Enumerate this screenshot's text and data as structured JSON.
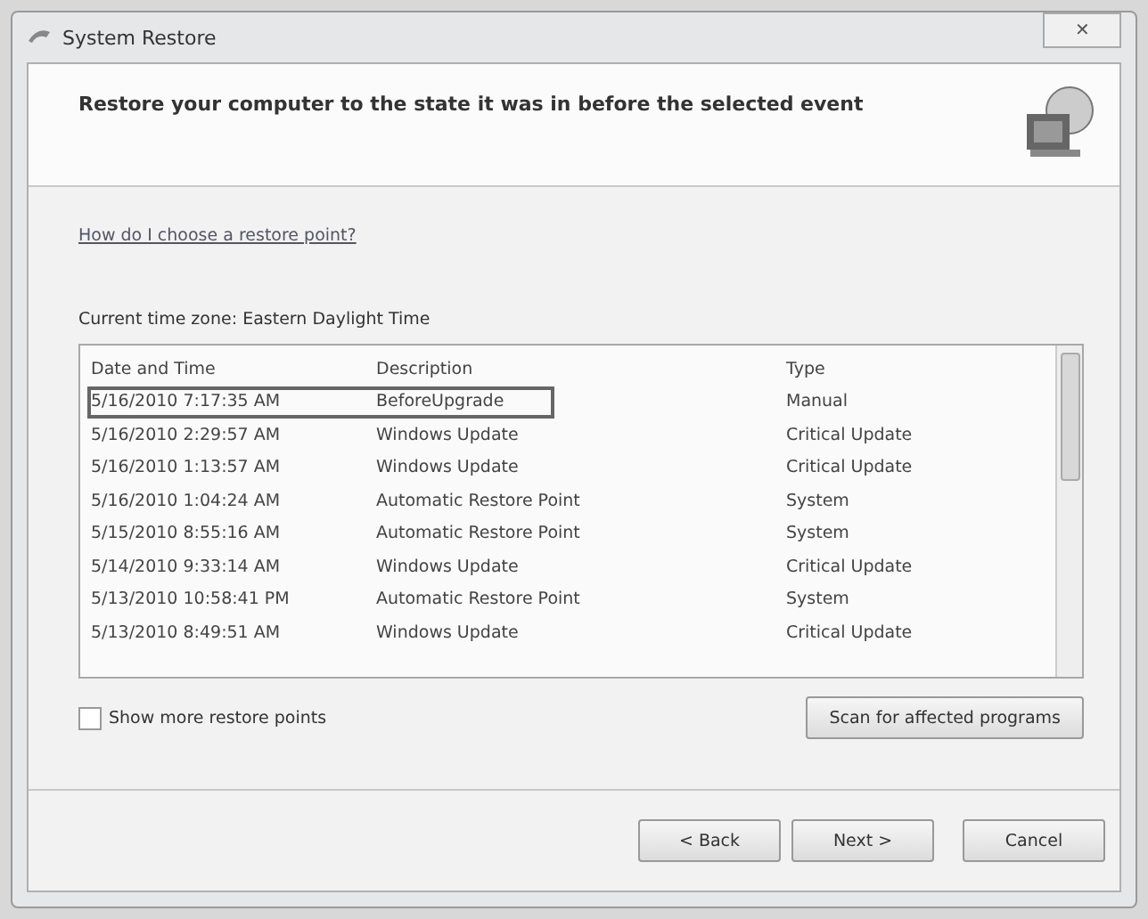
{
  "window": {
    "title": "System Restore",
    "close": "✕"
  },
  "header": {
    "heading": "Restore your computer to the state it was in before the selected event"
  },
  "help_link": "How do I choose a restore point?",
  "time_zone": "Current time zone: Eastern Daylight Time",
  "table": {
    "columns": [
      "Date and Time",
      "Description",
      "Type"
    ],
    "rows": [
      {
        "date": "5/16/2010 7:17:35 AM",
        "description": "BeforeUpgrade",
        "type": "Manual",
        "selected": true
      },
      {
        "date": "5/16/2010 2:29:57 AM",
        "description": "Windows Update",
        "type": "Critical Update",
        "selected": false
      },
      {
        "date": "5/16/2010 1:13:57 AM",
        "description": "Windows Update",
        "type": "Critical Update",
        "selected": false
      },
      {
        "date": "5/16/2010 1:04:24 AM",
        "description": "Automatic Restore Point",
        "type": "System",
        "selected": false
      },
      {
        "date": "5/15/2010 8:55:16 AM",
        "description": "Automatic Restore Point",
        "type": "System",
        "selected": false
      },
      {
        "date": "5/14/2010 9:33:14 AM",
        "description": "Windows Update",
        "type": "Critical Update",
        "selected": false
      },
      {
        "date": "5/13/2010 10:58:41 PM",
        "description": "Automatic Restore Point",
        "type": "System",
        "selected": false
      },
      {
        "date": "5/13/2010 8:49:51 AM",
        "description": "Windows Update",
        "type": "Critical Update",
        "selected": false
      }
    ]
  },
  "show_more": {
    "label": "Show more restore points",
    "checked": false
  },
  "scan_button": "Scan for affected programs",
  "buttons": [
    "< Back",
    "Next >",
    "Cancel"
  ]
}
